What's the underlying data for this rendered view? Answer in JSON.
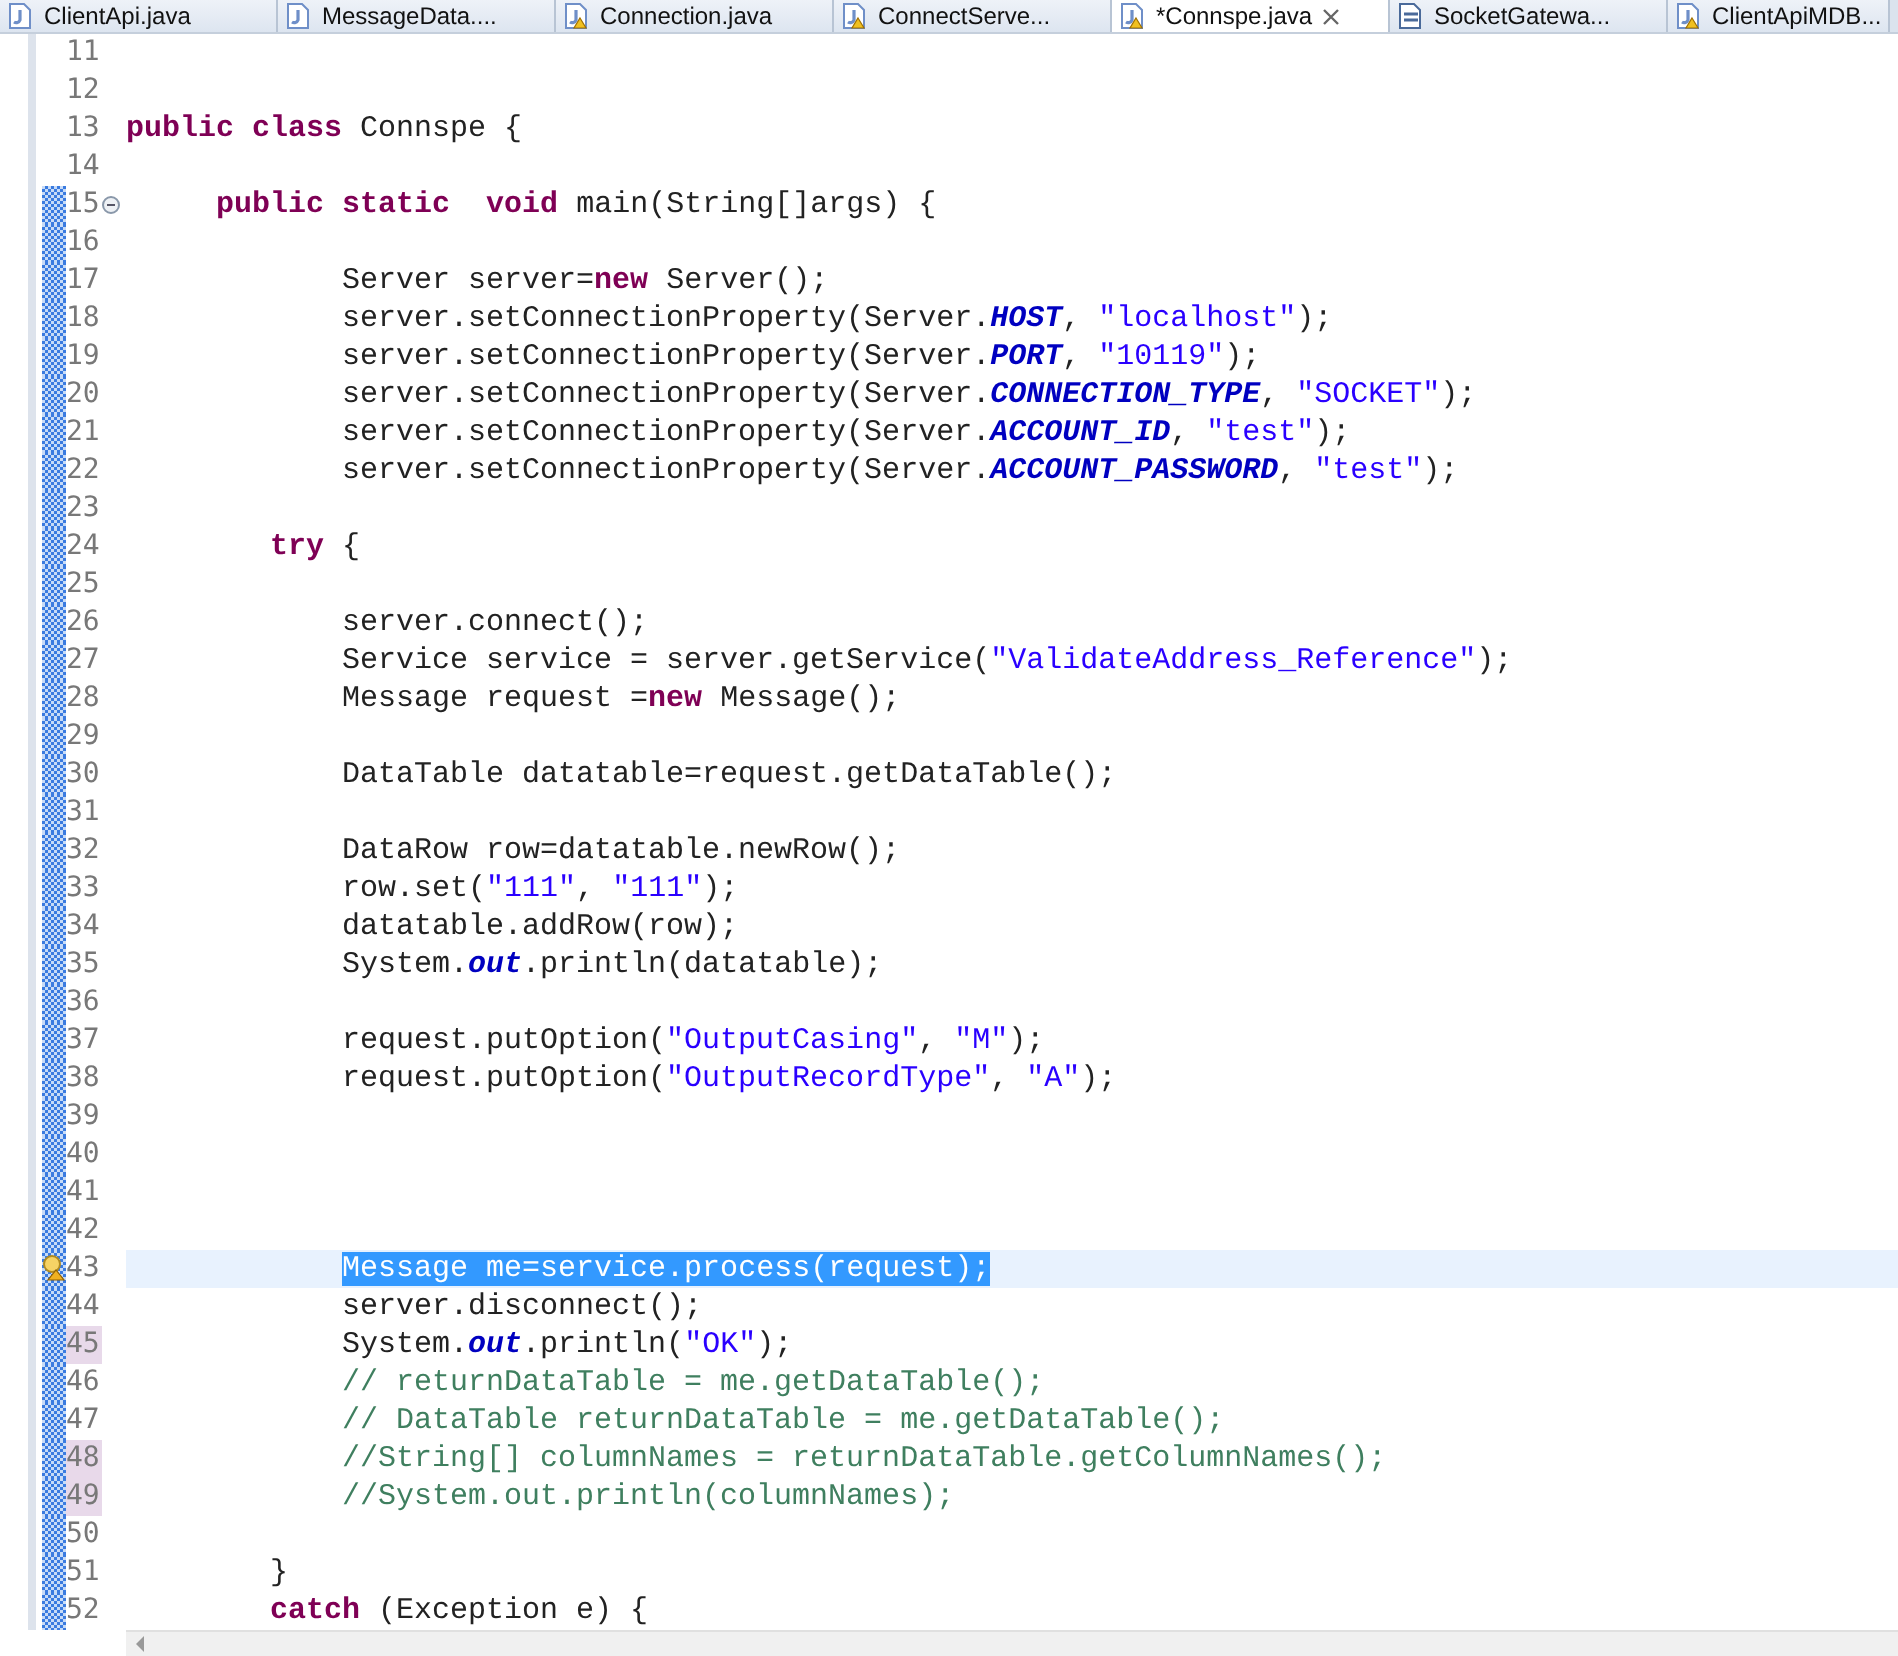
{
  "tabs": [
    {
      "label": "ClientApi.java",
      "kind": "java",
      "warning": false,
      "selected": false
    },
    {
      "label": "MessageData....",
      "kind": "java",
      "warning": false,
      "selected": false
    },
    {
      "label": "Connection.java",
      "kind": "java",
      "warning": true,
      "selected": false
    },
    {
      "label": "ConnectServe...",
      "kind": "java",
      "warning": true,
      "selected": false
    },
    {
      "label": "*Connspe.java",
      "kind": "java",
      "warning": true,
      "selected": true
    },
    {
      "label": "SocketGatewa...",
      "kind": "class",
      "warning": false,
      "selected": false
    },
    {
      "label": "ClientApiMDB...",
      "kind": "java",
      "warning": true,
      "selected": false
    }
  ],
  "lines": [
    {
      "number": "11",
      "changed": false,
      "marked": false,
      "current": false,
      "fold": false,
      "warning": false
    },
    {
      "number": "12",
      "changed": false,
      "marked": false,
      "current": false,
      "fold": false,
      "warning": false
    },
    {
      "number": "13",
      "changed": false,
      "marked": false,
      "current": false,
      "fold": false,
      "warning": false,
      "segments": [
        {
          "kind": "kw",
          "t": "public"
        },
        {
          "kind": "kw",
          "t": " class"
        },
        {
          "kind": "plain",
          "t": " Connspe {"
        }
      ]
    },
    {
      "number": "14",
      "changed": false,
      "marked": false,
      "current": false,
      "fold": false,
      "warning": false
    },
    {
      "number": "15",
      "changed": true,
      "marked": false,
      "current": false,
      "fold": true,
      "warning": false,
      "segments": [
        {
          "kind": "kw",
          "t": "     public"
        },
        {
          "kind": "kw",
          "t": " static"
        },
        {
          "kind": "kw",
          "t": "  void"
        },
        {
          "kind": "plain",
          "t": " main(String[]args) {"
        }
      ]
    },
    {
      "number": "16",
      "changed": true,
      "marked": false,
      "current": false,
      "fold": false,
      "warning": false
    },
    {
      "number": "17",
      "changed": true,
      "marked": false,
      "current": false,
      "fold": false,
      "warning": false,
      "segments": [
        {
          "kind": "plain",
          "t": "            Server server="
        },
        {
          "kind": "kw",
          "t": "new"
        },
        {
          "kind": "plain",
          "t": " Server();"
        }
      ]
    },
    {
      "number": "18",
      "changed": true,
      "marked": false,
      "current": false,
      "fold": false,
      "warning": false,
      "segments": [
        {
          "kind": "plain",
          "t": "            server.setConnectionProperty(Server."
        },
        {
          "kind": "field",
          "t": "HOST"
        },
        {
          "kind": "plain",
          "t": ", "
        },
        {
          "kind": "str",
          "t": "\"localhost\""
        },
        {
          "kind": "plain",
          "t": ");"
        }
      ]
    },
    {
      "number": "19",
      "changed": true,
      "marked": false,
      "current": false,
      "fold": false,
      "warning": false,
      "segments": [
        {
          "kind": "plain",
          "t": "            server.setConnectionProperty(Server."
        },
        {
          "kind": "field",
          "t": "PORT"
        },
        {
          "kind": "plain",
          "t": ", "
        },
        {
          "kind": "str",
          "t": "\"10119\""
        },
        {
          "kind": "plain",
          "t": ");"
        }
      ]
    },
    {
      "number": "20",
      "changed": true,
      "marked": false,
      "current": false,
      "fold": false,
      "warning": false,
      "segments": [
        {
          "kind": "plain",
          "t": "            server.setConnectionProperty(Server."
        },
        {
          "kind": "field",
          "t": "CONNECTION_TYPE"
        },
        {
          "kind": "plain",
          "t": ", "
        },
        {
          "kind": "str",
          "t": "\"SOCKET\""
        },
        {
          "kind": "plain",
          "t": ");"
        }
      ]
    },
    {
      "number": "21",
      "changed": true,
      "marked": false,
      "current": false,
      "fold": false,
      "warning": false,
      "segments": [
        {
          "kind": "plain",
          "t": "            server.setConnectionProperty(Server."
        },
        {
          "kind": "field",
          "t": "ACCOUNT_ID"
        },
        {
          "kind": "plain",
          "t": ", "
        },
        {
          "kind": "str",
          "t": "\"test\""
        },
        {
          "kind": "plain",
          "t": ");"
        }
      ]
    },
    {
      "number": "22",
      "changed": true,
      "marked": false,
      "current": false,
      "fold": false,
      "warning": false,
      "segments": [
        {
          "kind": "plain",
          "t": "            server.setConnectionProperty(Server."
        },
        {
          "kind": "field",
          "t": "ACCOUNT_PASSWORD"
        },
        {
          "kind": "plain",
          "t": ", "
        },
        {
          "kind": "str",
          "t": "\"test\""
        },
        {
          "kind": "plain",
          "t": ");"
        }
      ]
    },
    {
      "number": "23",
      "changed": true,
      "marked": false,
      "current": false,
      "fold": false,
      "warning": false
    },
    {
      "number": "24",
      "changed": true,
      "marked": false,
      "current": false,
      "fold": false,
      "warning": false,
      "segments": [
        {
          "kind": "kw",
          "t": "        try"
        },
        {
          "kind": "plain",
          "t": " {"
        }
      ]
    },
    {
      "number": "25",
      "changed": true,
      "marked": false,
      "current": false,
      "fold": false,
      "warning": false
    },
    {
      "number": "26",
      "changed": true,
      "marked": false,
      "current": false,
      "fold": false,
      "warning": false,
      "segments": [
        {
          "kind": "plain",
          "t": "            server.connect();"
        }
      ]
    },
    {
      "number": "27",
      "changed": true,
      "marked": false,
      "current": false,
      "fold": false,
      "warning": false,
      "segments": [
        {
          "kind": "plain",
          "t": "            Service service = server.getService("
        },
        {
          "kind": "str",
          "t": "\"ValidateAddress_Reference\""
        },
        {
          "kind": "plain",
          "t": ");"
        }
      ]
    },
    {
      "number": "28",
      "changed": true,
      "marked": false,
      "current": false,
      "fold": false,
      "warning": false,
      "segments": [
        {
          "kind": "plain",
          "t": "            Message request ="
        },
        {
          "kind": "kw",
          "t": "new"
        },
        {
          "kind": "plain",
          "t": " Message();"
        }
      ]
    },
    {
      "number": "29",
      "changed": true,
      "marked": false,
      "current": false,
      "fold": false,
      "warning": false
    },
    {
      "number": "30",
      "changed": true,
      "marked": false,
      "current": false,
      "fold": false,
      "warning": false,
      "segments": [
        {
          "kind": "plain",
          "t": "            DataTable datatable=request.getDataTable();"
        }
      ]
    },
    {
      "number": "31",
      "changed": true,
      "marked": false,
      "current": false,
      "fold": false,
      "warning": false
    },
    {
      "number": "32",
      "changed": true,
      "marked": false,
      "current": false,
      "fold": false,
      "warning": false,
      "segments": [
        {
          "kind": "plain",
          "t": "            DataRow row=datatable.newRow();"
        }
      ]
    },
    {
      "number": "33",
      "changed": true,
      "marked": false,
      "current": false,
      "fold": false,
      "warning": false,
      "segments": [
        {
          "kind": "plain",
          "t": "            row.set("
        },
        {
          "kind": "str",
          "t": "\"111\""
        },
        {
          "kind": "plain",
          "t": ", "
        },
        {
          "kind": "str",
          "t": "\"111\""
        },
        {
          "kind": "plain",
          "t": ");"
        }
      ]
    },
    {
      "number": "34",
      "changed": true,
      "marked": false,
      "current": false,
      "fold": false,
      "warning": false,
      "segments": [
        {
          "kind": "plain",
          "t": "            datatable.addRow(row);"
        }
      ]
    },
    {
      "number": "35",
      "changed": true,
      "marked": false,
      "current": false,
      "fold": false,
      "warning": false,
      "segments": [
        {
          "kind": "plain",
          "t": "            System."
        },
        {
          "kind": "static",
          "t": "out"
        },
        {
          "kind": "plain",
          "t": ".println(datatable);"
        }
      ]
    },
    {
      "number": "36",
      "changed": true,
      "marked": false,
      "current": false,
      "fold": false,
      "warning": false
    },
    {
      "number": "37",
      "changed": true,
      "marked": false,
      "current": false,
      "fold": false,
      "warning": false,
      "segments": [
        {
          "kind": "plain",
          "t": "            request.putOption("
        },
        {
          "kind": "str",
          "t": "\"OutputCasing\""
        },
        {
          "kind": "plain",
          "t": ", "
        },
        {
          "kind": "str",
          "t": "\"M\""
        },
        {
          "kind": "plain",
          "t": ");"
        }
      ]
    },
    {
      "number": "38",
      "changed": true,
      "marked": false,
      "current": false,
      "fold": false,
      "warning": false,
      "segments": [
        {
          "kind": "plain",
          "t": "            request.putOption("
        },
        {
          "kind": "str",
          "t": "\"OutputRecordType\""
        },
        {
          "kind": "plain",
          "t": ", "
        },
        {
          "kind": "str",
          "t": "\"A\""
        },
        {
          "kind": "plain",
          "t": ");"
        }
      ]
    },
    {
      "number": "39",
      "changed": true,
      "marked": false,
      "current": false,
      "fold": false,
      "warning": false
    },
    {
      "number": "40",
      "changed": true,
      "marked": false,
      "current": false,
      "fold": false,
      "warning": false
    },
    {
      "number": "41",
      "changed": true,
      "marked": false,
      "current": false,
      "fold": false,
      "warning": false
    },
    {
      "number": "42",
      "changed": true,
      "marked": false,
      "current": false,
      "fold": false,
      "warning": false
    },
    {
      "number": "43",
      "changed": true,
      "marked": false,
      "current": true,
      "fold": false,
      "warning": true,
      "segments": [
        {
          "kind": "sel",
          "t": "            Message me=service.process(request);"
        }
      ]
    },
    {
      "number": "44",
      "changed": true,
      "marked": false,
      "current": false,
      "fold": false,
      "warning": false,
      "segments": [
        {
          "kind": "plain",
          "t": "            server.disconnect();"
        }
      ]
    },
    {
      "number": "45",
      "changed": true,
      "marked": true,
      "current": false,
      "fold": false,
      "warning": false,
      "segments": [
        {
          "kind": "plain",
          "t": "            System."
        },
        {
          "kind": "static",
          "t": "out"
        },
        {
          "kind": "plain",
          "t": ".println("
        },
        {
          "kind": "str",
          "t": "\"OK\""
        },
        {
          "kind": "plain",
          "t": ");"
        }
      ]
    },
    {
      "number": "46",
      "changed": true,
      "marked": false,
      "current": false,
      "fold": false,
      "warning": false,
      "segments": [
        {
          "kind": "comment",
          "t": "            // returnDataTable = me.getDataTable();"
        }
      ]
    },
    {
      "number": "47",
      "changed": true,
      "marked": false,
      "current": false,
      "fold": false,
      "warning": false,
      "segments": [
        {
          "kind": "comment",
          "t": "            // DataTable returnDataTable = me.getDataTable();"
        }
      ]
    },
    {
      "number": "48",
      "changed": true,
      "marked": true,
      "current": false,
      "fold": false,
      "warning": false,
      "segments": [
        {
          "kind": "comment",
          "t": "            //String[] columnNames = returnDataTable.getColumnNames();"
        }
      ]
    },
    {
      "number": "49",
      "changed": true,
      "marked": true,
      "current": false,
      "fold": false,
      "warning": false,
      "segments": [
        {
          "kind": "comment",
          "t": "            //System.out.println(columnNames);"
        }
      ]
    },
    {
      "number": "50",
      "changed": true,
      "marked": false,
      "current": false,
      "fold": false,
      "warning": false
    },
    {
      "number": "51",
      "changed": true,
      "marked": false,
      "current": false,
      "fold": false,
      "warning": false,
      "segments": [
        {
          "kind": "plain",
          "t": "        }"
        }
      ]
    },
    {
      "number": "52",
      "changed": true,
      "marked": false,
      "current": false,
      "fold": false,
      "warning": false,
      "segments": [
        {
          "kind": "kw",
          "t": "        catch"
        },
        {
          "kind": "plain",
          "t": " (Exception e) {"
        }
      ]
    }
  ]
}
